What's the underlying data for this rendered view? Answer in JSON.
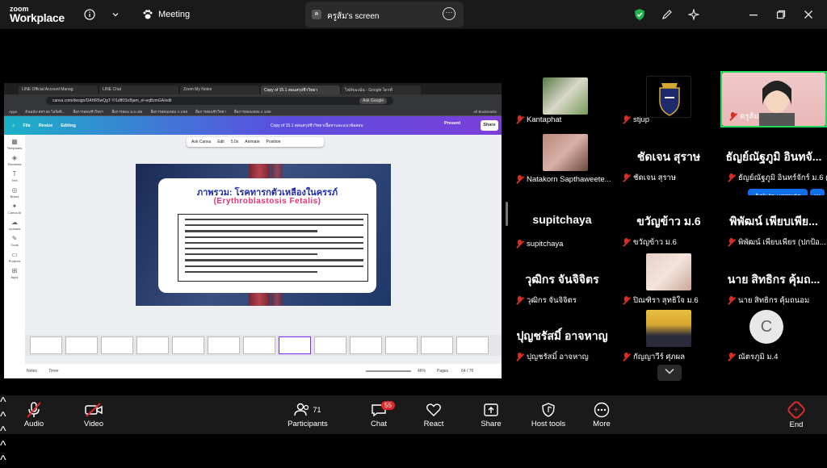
{
  "app": {
    "brand_line1": "zoom",
    "brand_line2": "Workplace"
  },
  "top": {
    "meeting_label": "Meeting",
    "share_tab_label": "ครูส้ม's screen",
    "share_avatar": "ค"
  },
  "browser": {
    "tabs": [
      "LINE Official Account Manag",
      "LINE Chat",
      "Zoom My Notes",
      "Copy of 15.1 สอนสรุปชีววิทยา",
      "ไฟล์ของฉัน - Google ไดรฟ์"
    ],
    "url": "canva.com/design/DAHR5wQgT-Y/1dIf0SnBjam_eI-eqBzmGA/edit",
    "ask_google": "Ask Google",
    "bookmarks": [
      "Apps",
      "ต้นฉบับ-สทร.65 โลจิสติ...",
      "สื่อการสอนชีววิทยา",
      "สื่อการสอน ม.6 เล่ม",
      "สื่อการสอนเทอม 4 1/69",
      "สื่อการสอนชีววิทยา",
      "สื่อการสอนเทอม 4 1/69",
      "All Bookmarks"
    ]
  },
  "canva": {
    "file": "File",
    "resize": "Resize",
    "editing": "Editing",
    "doc_title": "Copy of 15.1 สอนสรุปชีววิทยาเนื้อหาและแนวข้อสอบ",
    "present": "Present",
    "share": "Share",
    "sidebar": [
      "Templates",
      "Elements",
      "Text",
      "Brand",
      "Canva AI",
      "Uploads",
      "Tools",
      "Projects",
      "Apps"
    ],
    "ctx": [
      "Ask Canva",
      "Edit",
      "5.0s",
      "Animate",
      "Position"
    ],
    "slide_title_th": "ภาพรวม: โรคทารกตัวเหลืองในครรภ์",
    "slide_title_en": "(Erythroblastosis Fetalis)",
    "notes": "Notes",
    "timer": "Timer",
    "zoom": "46%",
    "pages_label": "Pages",
    "page_num": "64 / 76"
  },
  "participants_tiles": [
    {
      "name": "Kantaphat"
    },
    {
      "name": "stjup"
    },
    {
      "name": "ครูส้ม"
    },
    {
      "name": "Natakorn Sapthaweete..."
    },
    {
      "name": "ชัดเจน สุราษ",
      "big": "ชัดเจน สุราษ"
    },
    {
      "name": "ธัญย์ณัฐภูมิ อินทร์จักร์ ม.6 (...",
      "big": "ธัญย์ณัฐภูมิ อินทจั..."
    },
    {
      "name": "supitchaya",
      "big": "supitchaya"
    },
    {
      "name": "ขวัญข้าว ม.6",
      "big": "ขวัญข้าว ม.6"
    },
    {
      "name": "พิพัฒน์ เพียบเพียร (ปกป้อ...",
      "big": "พิพัฒน์ เพียบเพีย..."
    },
    {
      "name": "วุฒิกร จันจิจิตร",
      "big": "วุฒิกร จันจิจิตร"
    },
    {
      "name": "ปิณฑิรา สุทธิใจ ม.6"
    },
    {
      "name": "นาย สิทธิกร คุ้มถนอม",
      "big": "นาย สิทธิกร คุ้มถ..."
    },
    {
      "name": "ปุญชรัสมิ์ อาจหาญ",
      "big": "ปุญชรัสมิ์ อาจหาญ"
    },
    {
      "name": "กัญญาวีร์ ศุภผล"
    },
    {
      "name": "ณัตรภูมิ ม.4",
      "initial": "C"
    }
  ],
  "ask_to_unmute": "Ask to unmute",
  "bottom": {
    "audio": "Audio",
    "video": "Video",
    "participants": "Participants",
    "participants_count": "71",
    "chat": "Chat",
    "chat_badge": "55",
    "react": "React",
    "share": "Share",
    "host_tools": "Host tools",
    "more": "More",
    "end": "End"
  },
  "colors": {
    "zoom_blue": "#0e71eb",
    "mute_red": "#d92d20",
    "end_red": "#e02828",
    "canva_purple": "#7d2ae8",
    "shield_green": "#22b14c"
  }
}
